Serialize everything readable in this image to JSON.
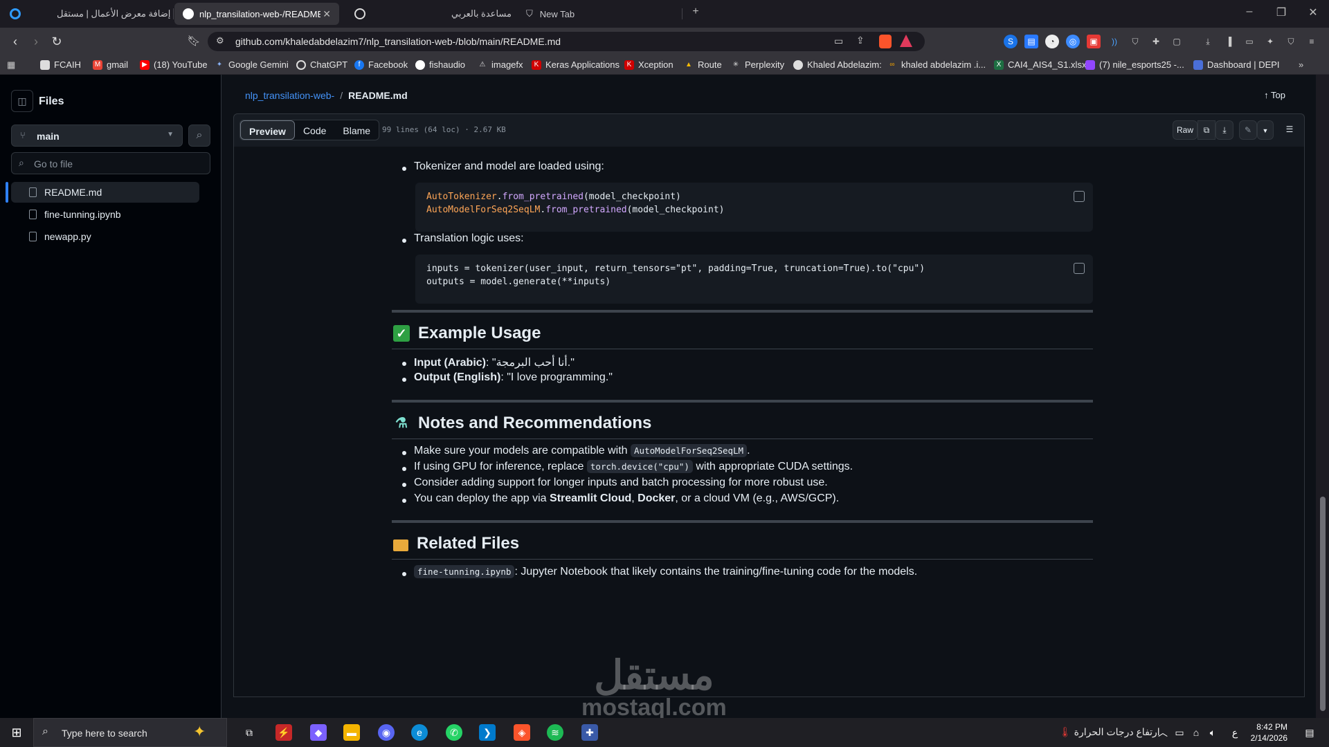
{
  "browser": {
    "tabs": [
      {
        "title": "إضافة معرض الأعمال | مستقل",
        "active": false
      },
      {
        "title": "nlp_transilation-web-/README.m",
        "active": true
      },
      {
        "title": "",
        "active": false
      },
      {
        "title": "مساعدة بالعربي",
        "active": false
      },
      {
        "title": "New Tab",
        "active": false
      }
    ],
    "url": "github.com/khaledabdelazim7/nlp_transilation-web-/blob/main/README.md",
    "bookmarks": [
      "FCAIH",
      "gmail",
      "(18) YouTube",
      "Google Gemini",
      "ChatGPT",
      "Facebook",
      "fishaudio",
      "imagefx",
      "Keras Applications",
      "Xception",
      "Route",
      "Perplexity",
      "Khaled Abdelazim:",
      "khaled abdelazim .i...",
      "CAI4_AIS4_S1.xlsx",
      "(7) nile_esports25 -...",
      "Dashboard | DEPI"
    ]
  },
  "sidebar": {
    "title": "Files",
    "branch": "main",
    "search_placeholder": "Go to file",
    "files": [
      "README.md",
      "fine-tunning.ipynb",
      "newapp.py"
    ]
  },
  "header": {
    "repo": "nlp_transilation-web-",
    "separator": "/",
    "file": "README.md",
    "top_label": "Top",
    "tabs": [
      "Preview",
      "Code",
      "Blame"
    ],
    "file_info": "99 lines (64 loc) · 2.67 KB",
    "raw_label": "Raw"
  },
  "content": {
    "bullet_tokenizer": "Tokenizer and model are loaded using:",
    "code1": {
      "l1a": "AutoTokenizer",
      "l1b": ".",
      "l1c": "from_pretrained",
      "l1d": "(model_checkpoint)",
      "l2a": "AutoModelForSeq2SeqLM",
      "l2b": ".",
      "l2c": "from_pretrained",
      "l2d": "(model_checkpoint)"
    },
    "bullet_translation": "Translation logic uses:",
    "code2": {
      "line1": "inputs = tokenizer(user_input, return_tensors=\"pt\", padding=True, truncation=True).to(\"cpu\")",
      "line2": "outputs = model.generate(**inputs)"
    },
    "h_example": "Example Usage",
    "input_label": "Input (Arabic)",
    "input_value": ": \"أنا أحب البرمجة.\"",
    "output_label": "Output (English)",
    "output_value": ": \"I love programming.\"",
    "h_notes": "Notes and Recommendations",
    "note1_pre": "Make sure your models are compatible with ",
    "note1_code": "AutoModelForSeq2SeqLM",
    "note1_post": ".",
    "note2_pre": "If using GPU for inference, replace ",
    "note2_code": "torch.device(\"cpu\")",
    "note2_post": " with appropriate CUDA settings.",
    "note3": "Consider adding support for longer inputs and batch processing for more robust use.",
    "note4_pre": "You can deploy the app via ",
    "note4_b1": "Streamlit Cloud",
    "note4_mid": ", ",
    "note4_b2": "Docker",
    "note4_post": ", or a cloud VM (e.g., AWS/GCP).",
    "h_related": "Related Files",
    "related_code": "fine-tunning.ipynb",
    "related_text": ": Jupyter Notebook that likely contains the training/fine-tuning code for the models."
  },
  "taskbar": {
    "search_placeholder": "Type here to search",
    "weather": "ارتفاع درجات الحرارة",
    "time": "8:42 PM",
    "date": "2/14/2026",
    "lang": "ع"
  },
  "watermark": {
    "line1": "مستقل",
    "line2": "mostaql.com"
  }
}
